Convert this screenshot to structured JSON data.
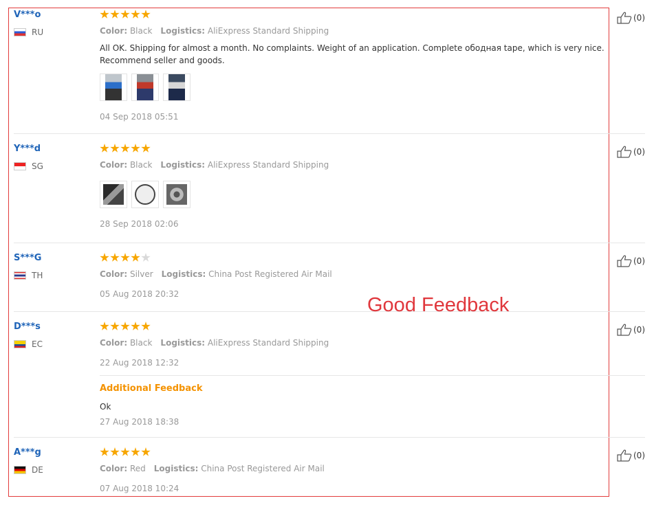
{
  "annotation": "Good Feedback",
  "labels": {
    "color": "Color:",
    "logistics": "Logistics:"
  },
  "reviews": [
    {
      "user": "V***o",
      "country": "RU",
      "stars": 5,
      "color": "Black",
      "logistics": "AliExpress Standard Shipping",
      "text": "All OK. Shipping for almost a month. No complaints. Weight of an application. Complete ободная tape, which is very nice. Recommend seller and goods.",
      "date": "04 Sep 2018 05:51",
      "likes": "(0)"
    },
    {
      "user": "Y***d",
      "country": "SG",
      "stars": 5,
      "color": "Black",
      "logistics": "AliExpress Standard Shipping",
      "date": "28 Sep 2018 02:06",
      "likes": "(0)"
    },
    {
      "user": "S***G",
      "country": "TH",
      "stars": 4,
      "color": "Silver",
      "logistics": "China Post Registered Air Mail",
      "date": "05 Aug 2018 20:32",
      "likes": "(0)"
    },
    {
      "user": "D***s",
      "country": "EC",
      "stars": 5,
      "color": "Black",
      "logistics": "AliExpress Standard Shipping",
      "date": "22 Aug 2018 12:32",
      "likes": "(0)",
      "additional": {
        "title": "Additional Feedback",
        "text": "Ok",
        "date": "27 Aug 2018 18:38"
      }
    },
    {
      "user": "A***g",
      "country": "DE",
      "stars": 5,
      "color": "Red",
      "logistics": "China Post Registered Air Mail",
      "date": "07 Aug 2018 10:24",
      "likes": "(0)"
    }
  ]
}
